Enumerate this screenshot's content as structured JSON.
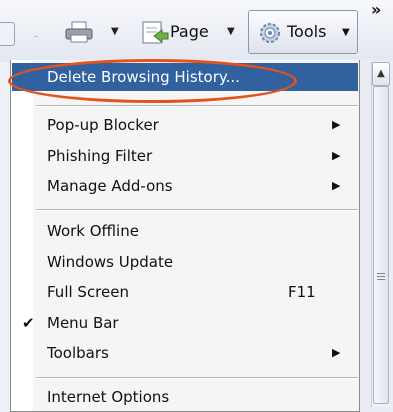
{
  "toolbar": {
    "page_label": "Page",
    "tools_label": "Tools",
    "more_glyph": "»"
  },
  "menu": {
    "items": [
      {
        "label": "Delete Browsing History...",
        "highlighted": true
      },
      {
        "label": "Pop-up Blocker",
        "submenu": true
      },
      {
        "label": "Phishing Filter",
        "submenu": true
      },
      {
        "label": "Manage Add-ons",
        "submenu": true
      },
      {
        "label": "Work Offline"
      },
      {
        "label": "Windows Update"
      },
      {
        "label": "Full Screen",
        "shortcut": "F11"
      },
      {
        "label": "Menu Bar",
        "checked": true
      },
      {
        "label": "Toolbars",
        "submenu": true
      },
      {
        "label": "Internet Options"
      }
    ]
  },
  "colors": {
    "highlight_bg": "#31619e",
    "annotation_oval": "#e2541d"
  }
}
